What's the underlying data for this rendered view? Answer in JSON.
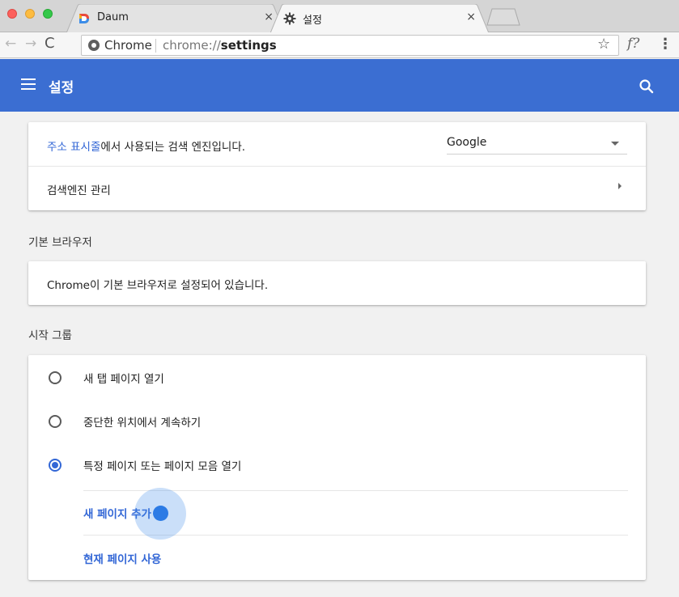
{
  "browser": {
    "tabs": [
      {
        "title": "Daum",
        "close_glyph": "×",
        "icon": "daum-favicon-icon"
      },
      {
        "title": "설정",
        "close_glyph": "×",
        "icon": "gear-icon"
      }
    ],
    "toolbar": {
      "back_glyph": "←",
      "forward_glyph": "→",
      "reload_glyph": "C",
      "chip_label": "Chrome",
      "url_prefix": "chrome://",
      "url_path": "settings",
      "star_glyph": "☆",
      "extension_glyph": "f?",
      "menu_glyph": "⋮"
    }
  },
  "header": {
    "title": "설정",
    "accent_color": "#3b6ed2"
  },
  "search_engine": {
    "address_bar_link": "주소 표시줄",
    "description_rest": "에서 사용되는 검색 엔진입니다.",
    "selected_engine": "Google",
    "manage_label": "검색엔진 관리"
  },
  "default_browser": {
    "section_title": "기본 브라우저",
    "status_text": "Chrome이 기본 브라우저로 설정되어 있습니다."
  },
  "startup": {
    "section_title": "시작 그룹",
    "options": [
      {
        "label": "새 탭 페이지 열기",
        "checked": false
      },
      {
        "label": "중단한 위치에서 계속하기",
        "checked": false
      },
      {
        "label": "특정 페이지 또는 페이지 모음 열기",
        "checked": true
      }
    ],
    "add_page_label": "새 페이지 추가",
    "use_current_label": "현재 페이지 사용"
  }
}
